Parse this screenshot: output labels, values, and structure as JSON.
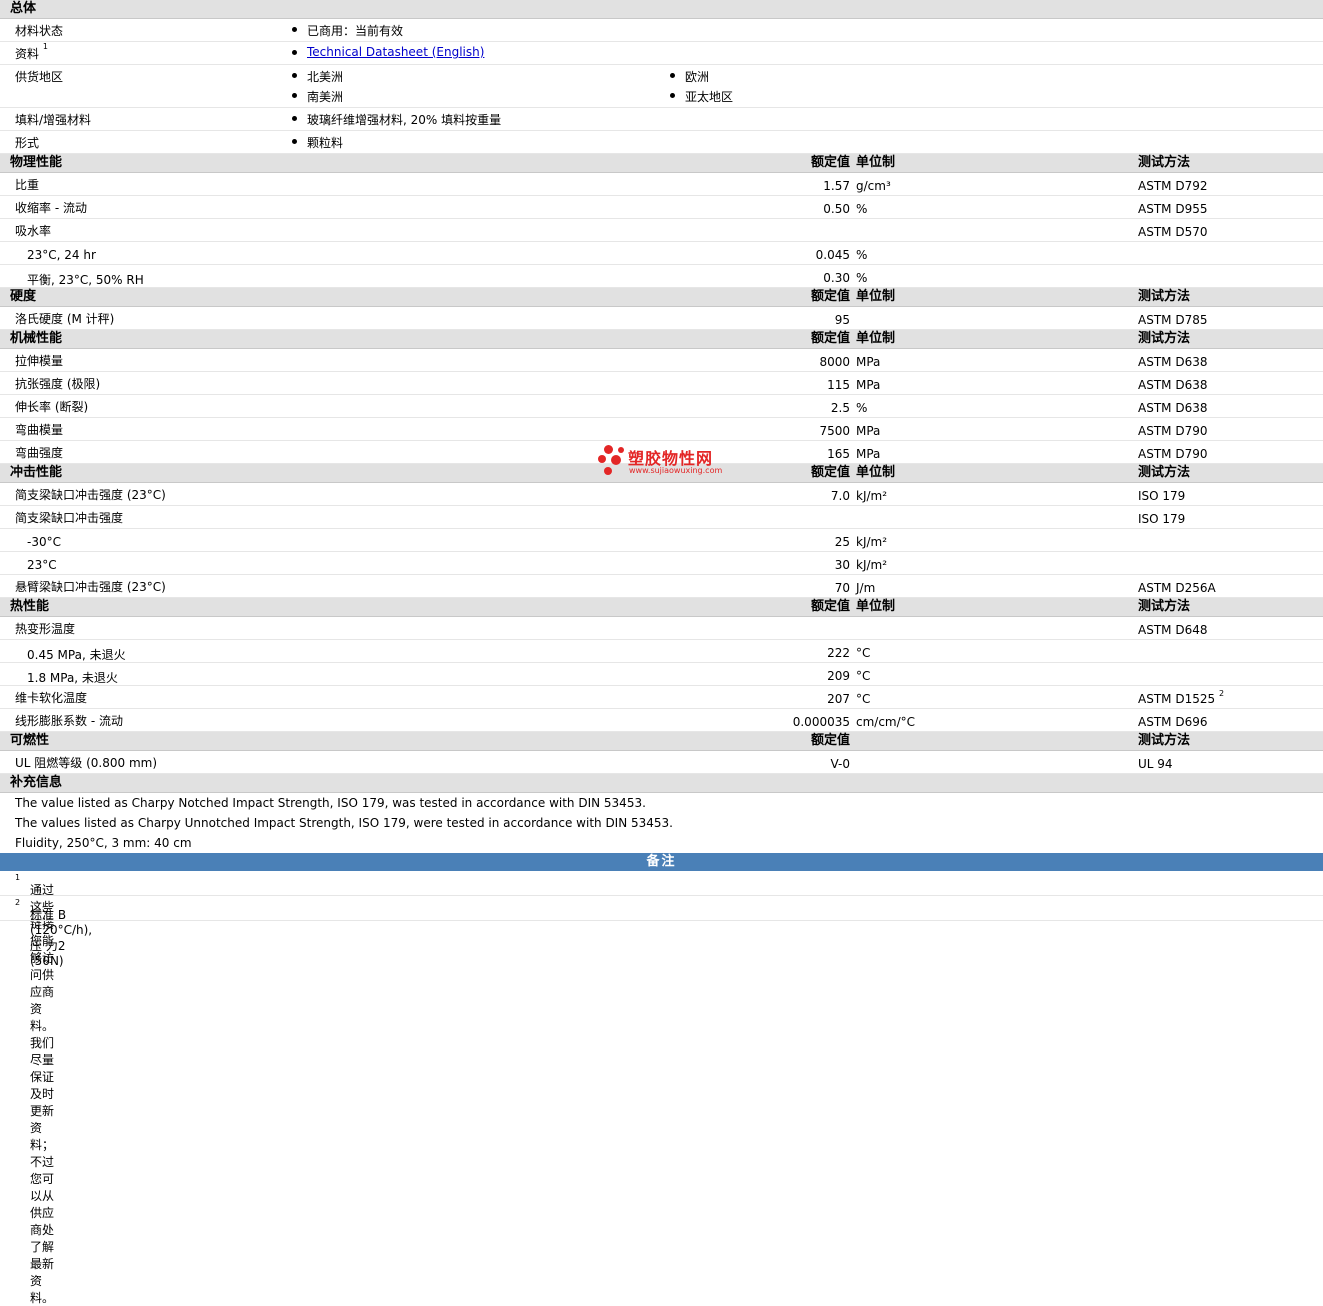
{
  "general": {
    "section_title": "总体",
    "status_label": "材料状态",
    "status_value": "已商用：当前有效",
    "docs_label": "资料",
    "docs_sup": "1",
    "docs_link": "Technical Datasheet (English)",
    "regions_label": "供货地区",
    "regions": [
      "北美洲",
      "欧洲",
      "南美洲",
      "亚太地区"
    ],
    "filler_label": "填料/增强材料",
    "filler_value": "玻璃纤维增强材料, 20% 填料按重量",
    "form_label": "形式",
    "form_value": "颗粒料"
  },
  "headers": {
    "value": "额定值",
    "unit": "单位制",
    "method": "测试方法"
  },
  "physical": {
    "title": "物理性能",
    "rows": [
      {
        "label": "比重",
        "value": "1.57",
        "unit": "g/cm³",
        "method": "ASTM D792"
      },
      {
        "label": "收缩率 - 流动",
        "value": "0.50",
        "unit": "%",
        "method": "ASTM D955"
      },
      {
        "label": "吸水率",
        "value": "",
        "unit": "",
        "method": "ASTM D570"
      },
      {
        "label": "23°C, 24 hr",
        "value": "0.045",
        "unit": "%",
        "method": ""
      },
      {
        "label": "平衡, 23°C, 50% RH",
        "value": "0.30",
        "unit": "%",
        "method": ""
      }
    ]
  },
  "hardness": {
    "title": "硬度",
    "rows": [
      {
        "label": "洛氏硬度 (M 计秤)",
        "value": "95",
        "unit": "",
        "method": "ASTM D785"
      }
    ]
  },
  "mechanical": {
    "title": "机械性能",
    "rows": [
      {
        "label": "拉伸模量",
        "value": "8000",
        "unit": "MPa",
        "method": "ASTM D638"
      },
      {
        "label": "抗张强度 (极限)",
        "value": "115",
        "unit": "MPa",
        "method": "ASTM D638"
      },
      {
        "label": "伸长率 (断裂)",
        "value": "2.5",
        "unit": "%",
        "method": "ASTM D638"
      },
      {
        "label": "弯曲模量",
        "value": "7500",
        "unit": "MPa",
        "method": "ASTM D790"
      },
      {
        "label": "弯曲强度",
        "value": "165",
        "unit": "MPa",
        "method": "ASTM D790"
      }
    ]
  },
  "impact": {
    "title": "冲击性能",
    "rows": [
      {
        "label": "简支梁缺口冲击强度 (23°C)",
        "value": "7.0",
        "unit": "kJ/m²",
        "method": "ISO 179"
      },
      {
        "label": "简支梁缺口冲击强度",
        "value": "",
        "unit": "",
        "method": "ISO 179"
      },
      {
        "label": "-30°C",
        "value": "25",
        "unit": "kJ/m²",
        "method": ""
      },
      {
        "label": "23°C",
        "value": "30",
        "unit": "kJ/m²",
        "method": ""
      },
      {
        "label": "悬臂梁缺口冲击强度 (23°C)",
        "value": "70",
        "unit": "J/m",
        "method": "ASTM D256A"
      }
    ]
  },
  "thermal": {
    "title": "热性能",
    "rows": [
      {
        "label": "热变形温度",
        "value": "",
        "unit": "",
        "method": "ASTM D648"
      },
      {
        "label": "0.45 MPa, 未退火",
        "value": "222",
        "unit": "°C",
        "method": ""
      },
      {
        "label": "1.8 MPa, 未退火",
        "value": "209",
        "unit": "°C",
        "method": ""
      },
      {
        "label": "维卡软化温度",
        "value": "207",
        "unit": "°C",
        "method": "ASTM D1525",
        "sup": "2"
      },
      {
        "label": "线形膨胀系数 - 流动",
        "value": "0.000035",
        "unit": "cm/cm/°C",
        "method": "ASTM D696"
      }
    ]
  },
  "flammability": {
    "title": "可燃性",
    "rows": [
      {
        "label": "UL 阻燃等级 (0.800 mm)",
        "value": "V-0",
        "unit": "",
        "method": "UL 94"
      }
    ]
  },
  "supplement": {
    "title": "补充信息",
    "lines": [
      "The value listed as Charpy Notched Impact Strength, ISO 179, was tested in accordance with DIN 53453.",
      "The values listed as Charpy Unnotched Impact Strength, ISO 179, were tested in accordance with DIN 53453.",
      "Fluidity, 250°C, 3 mm: 40 cm"
    ]
  },
  "remarks": {
    "title": "备注",
    "notes": [
      {
        "sup": "1",
        "text": "通过这些链接您能够访问供应商资料。我们尽量保证及时更新资料；不过您可以从供应商处了解最新资料。"
      },
      {
        "sup": "2",
        "text": "标准 B (120°C/h), 压 力2 (50N)"
      }
    ]
  },
  "watermark": {
    "name": "塑胶物性网",
    "url": "www.sujiaowuxing.com",
    "color": "#e32626"
  },
  "colors": {
    "section_bg": "#e1e1e1",
    "banner_bg": "#4a80b7",
    "link": "#0000cc"
  }
}
